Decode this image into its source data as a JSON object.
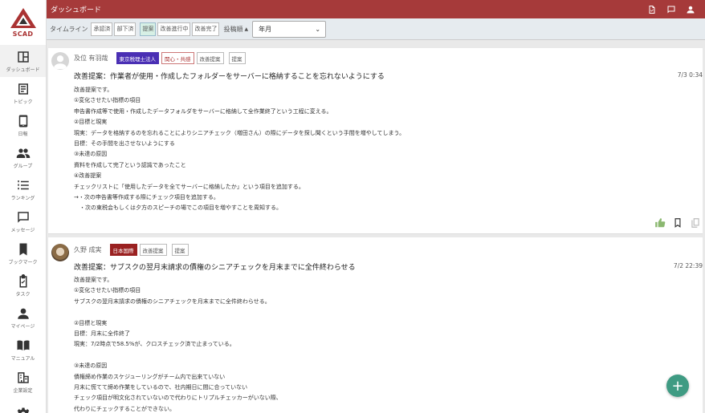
{
  "app": {
    "logo_text": "SCAD",
    "header_title": "ダッシュボード"
  },
  "sidebar": {
    "items": [
      {
        "label": "ダッシュボード",
        "icon": "dashboard-icon",
        "active": true
      },
      {
        "label": "トピック",
        "icon": "topic-icon"
      },
      {
        "label": "日報",
        "icon": "phone-icon"
      },
      {
        "label": "グループ",
        "icon": "group-icon"
      },
      {
        "label": "ランキング",
        "icon": "ranking-icon"
      },
      {
        "label": "メッセージ",
        "icon": "message-icon"
      },
      {
        "label": "ブックマーク",
        "icon": "bookmark-icon"
      },
      {
        "label": "タスク",
        "icon": "task-icon"
      },
      {
        "label": "マイページ",
        "icon": "person-icon"
      },
      {
        "label": "マニュアル",
        "icon": "manual-icon"
      },
      {
        "label": "企業設定",
        "icon": "building-icon"
      }
    ]
  },
  "toolbar": {
    "timeline_label": "タイムライン",
    "filters": [
      "承認済",
      "部下済",
      "提案",
      "改善進行中",
      "改善完了"
    ],
    "sort_label": "投稿順",
    "period_value": "年月"
  },
  "posts": [
    {
      "author": "及位 有羽哉",
      "tags": [
        "東京税理士法人",
        "関心・共感",
        "改善提案",
        "提案"
      ],
      "title": "改善提案：作業者が使用・作成したフォルダーをサーバーに格納することを忘れないようにする",
      "date": "7/3 0:34",
      "body": [
        "改善提案です。",
        "①変化させたい指標の項目",
        "申告書作成等で使用・作成したデータフォルダをサーバーに格納して全作業終了という工程に変える。",
        "②目標と現実",
        "現実：データを格納するのを忘れることによりシニアチェック（増田さん）の際にデータを探し聞くという手間を増やしてしまう。",
        "目標：その手間を出させないようにする",
        "③未達の原因",
        "資料を作成して完了という認識であったこと",
        "④改善提案",
        "チェックリストに「使用したデータを全てサーバーに格納したか」という項目を追加する。",
        "→・次の申告書等作成する際にチェック項目を追加する。",
        "　・次の東税会もしくは夕方のスピーチの場でこの項目を増やすことを周知する。"
      ]
    },
    {
      "author": "久野 成実",
      "tags": [
        "日本国際",
        "改善提案",
        "提案"
      ],
      "title": "改善提案：サブスクの翌月末請求の債権のシニアチェックを月末までに全件終わらせる",
      "date": "7/2 22:39",
      "body": [
        "改善提案です。",
        "①変化させたい指標の項目",
        "サブスクの翌月末請求の債権のシニアチェックを月末までに全件終わらせる。",
        "",
        "②目標と現実",
        "目標：月末に全件終了",
        "現実：7/2時点で58.5%が、クロスチェック済で止まっている。",
        "",
        "③未達の原因",
        "債権締め作業のスケジューリングがチーム内で出来ていない",
        "月末に慌てて締め作業をしているので、社内期日に間に合っていない",
        "チェック項目が明文化されていないので代わりにトリプルチェッカーがいない際、",
        "代わりにチェックすることができない。"
      ]
    }
  ],
  "colors": {
    "header": "#a63a3a",
    "fab": "#3f9b83",
    "company_blue": "#4a2fb4",
    "company_red": "#9a2121"
  }
}
